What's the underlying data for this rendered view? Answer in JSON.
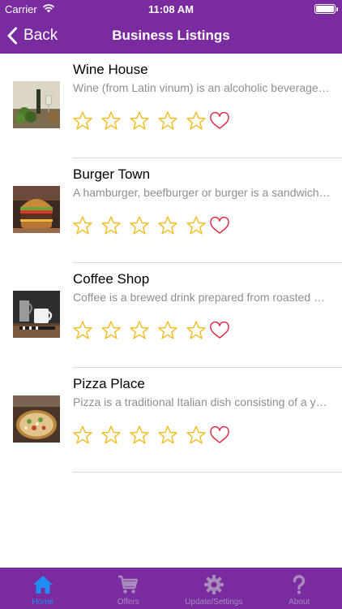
{
  "status_bar": {
    "carrier": "Carrier",
    "time": "11:08 AM"
  },
  "nav": {
    "back_label": "Back",
    "title": "Business Listings"
  },
  "listings": [
    {
      "name": "Wine House",
      "description": "Wine (from Latin vinum) is an alcoholic beverage made from fermented grapes",
      "rating": 0,
      "favorite": false,
      "image": "wine-photo"
    },
    {
      "name": "Burger Town",
      "description": "A hamburger, beefburger or burger is a sandwich consisting of one or more",
      "rating": 0,
      "favorite": false,
      "image": "burger-photo"
    },
    {
      "name": "Coffee Shop",
      "description": "Coffee is a brewed drink prepared from roasted coffee beans",
      "rating": 0,
      "favorite": false,
      "image": "coffee-photo"
    },
    {
      "name": "Pizza Place",
      "description": "Pizza is a traditional Italian dish consisting of a yeasted flatbread",
      "rating": 0,
      "favorite": false,
      "image": "pizza-photo"
    }
  ],
  "tabs": [
    {
      "label": "Home",
      "icon": "home-icon",
      "active": true
    },
    {
      "label": "Offers",
      "icon": "cart-icon",
      "active": false
    },
    {
      "label": "Update/Settings",
      "icon": "gear-icon",
      "active": false
    },
    {
      "label": "About",
      "icon": "question-icon",
      "active": false
    }
  ],
  "colors": {
    "brand": "#7a2ba0",
    "star": "#f2bb1f",
    "heart": "#e0203a",
    "active_tab": "#1e8cf0",
    "inactive_tab": "#a98bbd"
  }
}
